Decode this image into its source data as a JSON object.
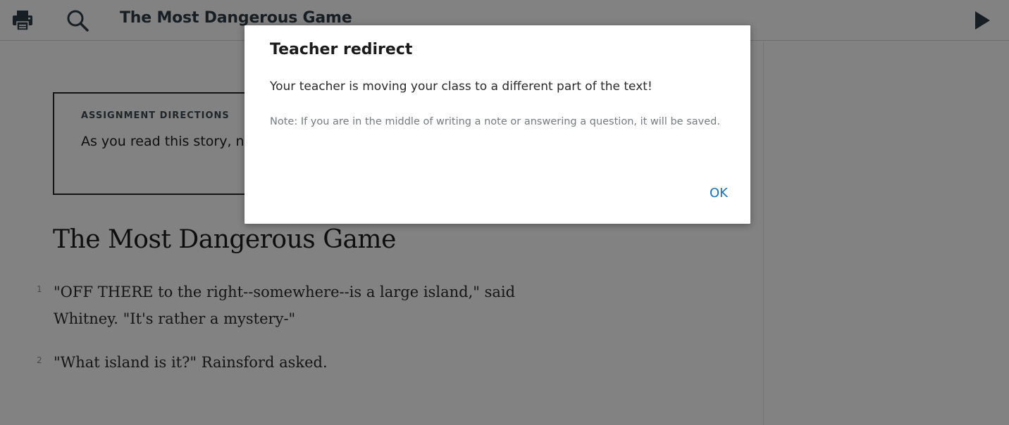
{
  "toolbar": {
    "title": "The Most Dangerous Game",
    "print_icon": "printer-icon",
    "search_icon": "magnifier-icon",
    "play_icon": "play-icon"
  },
  "directions": {
    "label": "ASSIGNMENT DIRECTIONS",
    "text": "As you read this story, n… and the hunted."
  },
  "story": {
    "title": "The Most Dangerous Game",
    "paragraphs": [
      {
        "number": "1",
        "text": "\"OFF THERE to the right--somewhere--is a large island,\" said Whitney. \"It's rather a mystery-\""
      },
      {
        "number": "2",
        "text": "\"What island is it?\" Rainsford asked."
      }
    ]
  },
  "modal": {
    "title": "Teacher redirect",
    "message": "Your teacher is moving your class to a different part of the text!",
    "note": "Note: If you are in the middle of writing a note or answering a question, it will be saved.",
    "ok_label": "OK"
  },
  "colors": {
    "toolbar_text": "#2f3e48",
    "link_blue": "#1a6fb8",
    "overlay": "rgba(0,0,0,0.49)"
  }
}
